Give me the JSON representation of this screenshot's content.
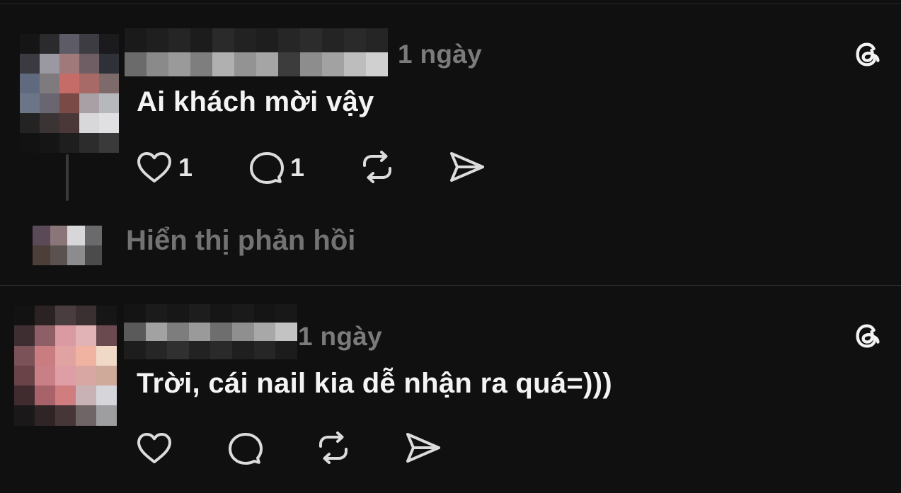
{
  "comments": [
    {
      "time": "1 ngày",
      "text": "Ai khách mời vậy",
      "likes": "1",
      "replies": "1",
      "show_replies_label": "Hiển thị phản hồi"
    },
    {
      "time": "1 ngày",
      "text": "Trời, cái nail kia dễ nhận ra quá=)))",
      "likes": "",
      "replies": ""
    }
  ],
  "colors": {
    "background": "#101010",
    "text": "#f4f4f4",
    "muted": "#7b7b7b",
    "icon": "#dcdcdc"
  },
  "icons": [
    "threads-icon",
    "heart-icon",
    "comment-icon",
    "repost-icon",
    "share-icon"
  ]
}
